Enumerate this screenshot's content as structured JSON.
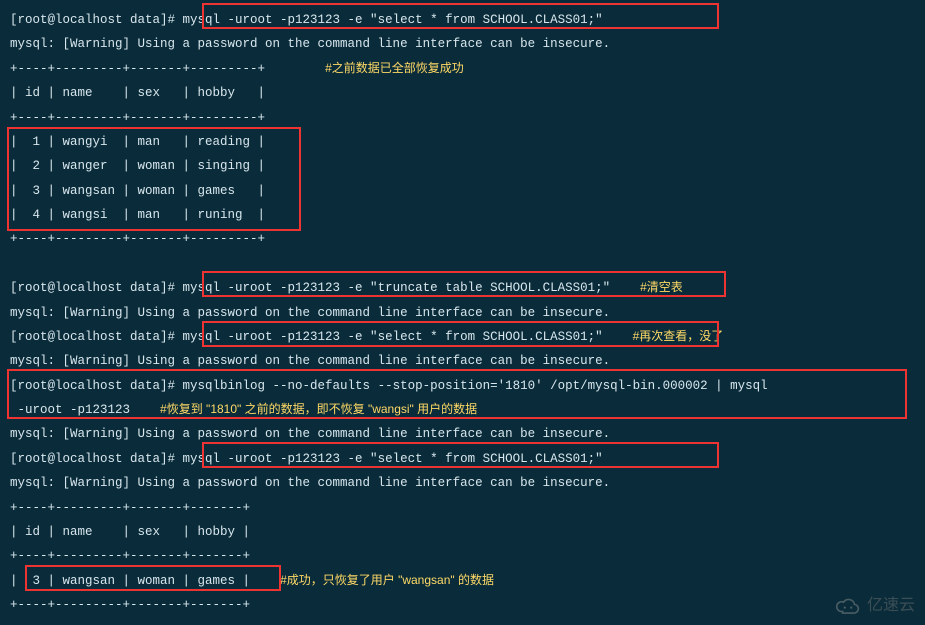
{
  "lines": {
    "l1_prompt": "[root@localhost data]# ",
    "l1_cmd": "mysql -uroot -p123123 -e \"select * from SCHOOL.CLASS01;\"",
    "warn": "mysql: [Warning] Using a password on the command line interface can be insecure.",
    "hr_top": "+----+---------+-------+---------+",
    "hdr": "| id | name    | sex   | hobby   |",
    "r1": "|  1 | wangyi  | man   | reading |",
    "r2": "|  2 | wanger  | woman | singing |",
    "r3": "|  3 | wangsan | woman | games   |",
    "r4": "|  4 | wangsi  | man   | runing  |",
    "l2_cmd": "mysql -uroot -p123123 -e \"truncate table SCHOOL.CLASS01;\"",
    "l3_cmd": "mysql -uroot -p123123 -e \"select * from SCHOOL.CLASS01;\"",
    "l4_cmd": "mysqlbinlog --no-defaults --stop-position='1810' /opt/mysql-bin.000002 | mysql ",
    "l4_cont": " -uroot -p123123",
    "l5_cmd": "mysql -uroot -p123123 -e \"select * from SCHOOL.CLASS01;\"",
    "hr2_top": "+----+---------+-------+-------+",
    "hdr2": "| id | name    | sex   | hobby |",
    "r2_3": "|  3 | wangsan | woman | games |"
  },
  "annot": {
    "a1": "#之前数据已全部恢复成功",
    "a2": "#清空表",
    "a3": "#再次查看，没了",
    "a4": "#恢复到 \"1810\" 之前的数据，即不恢复 \"wangsi\" 用户的数据",
    "a5": "#成功，只恢复了用户 \"wangsan\" 的数据"
  },
  "watermark": "亿速云"
}
